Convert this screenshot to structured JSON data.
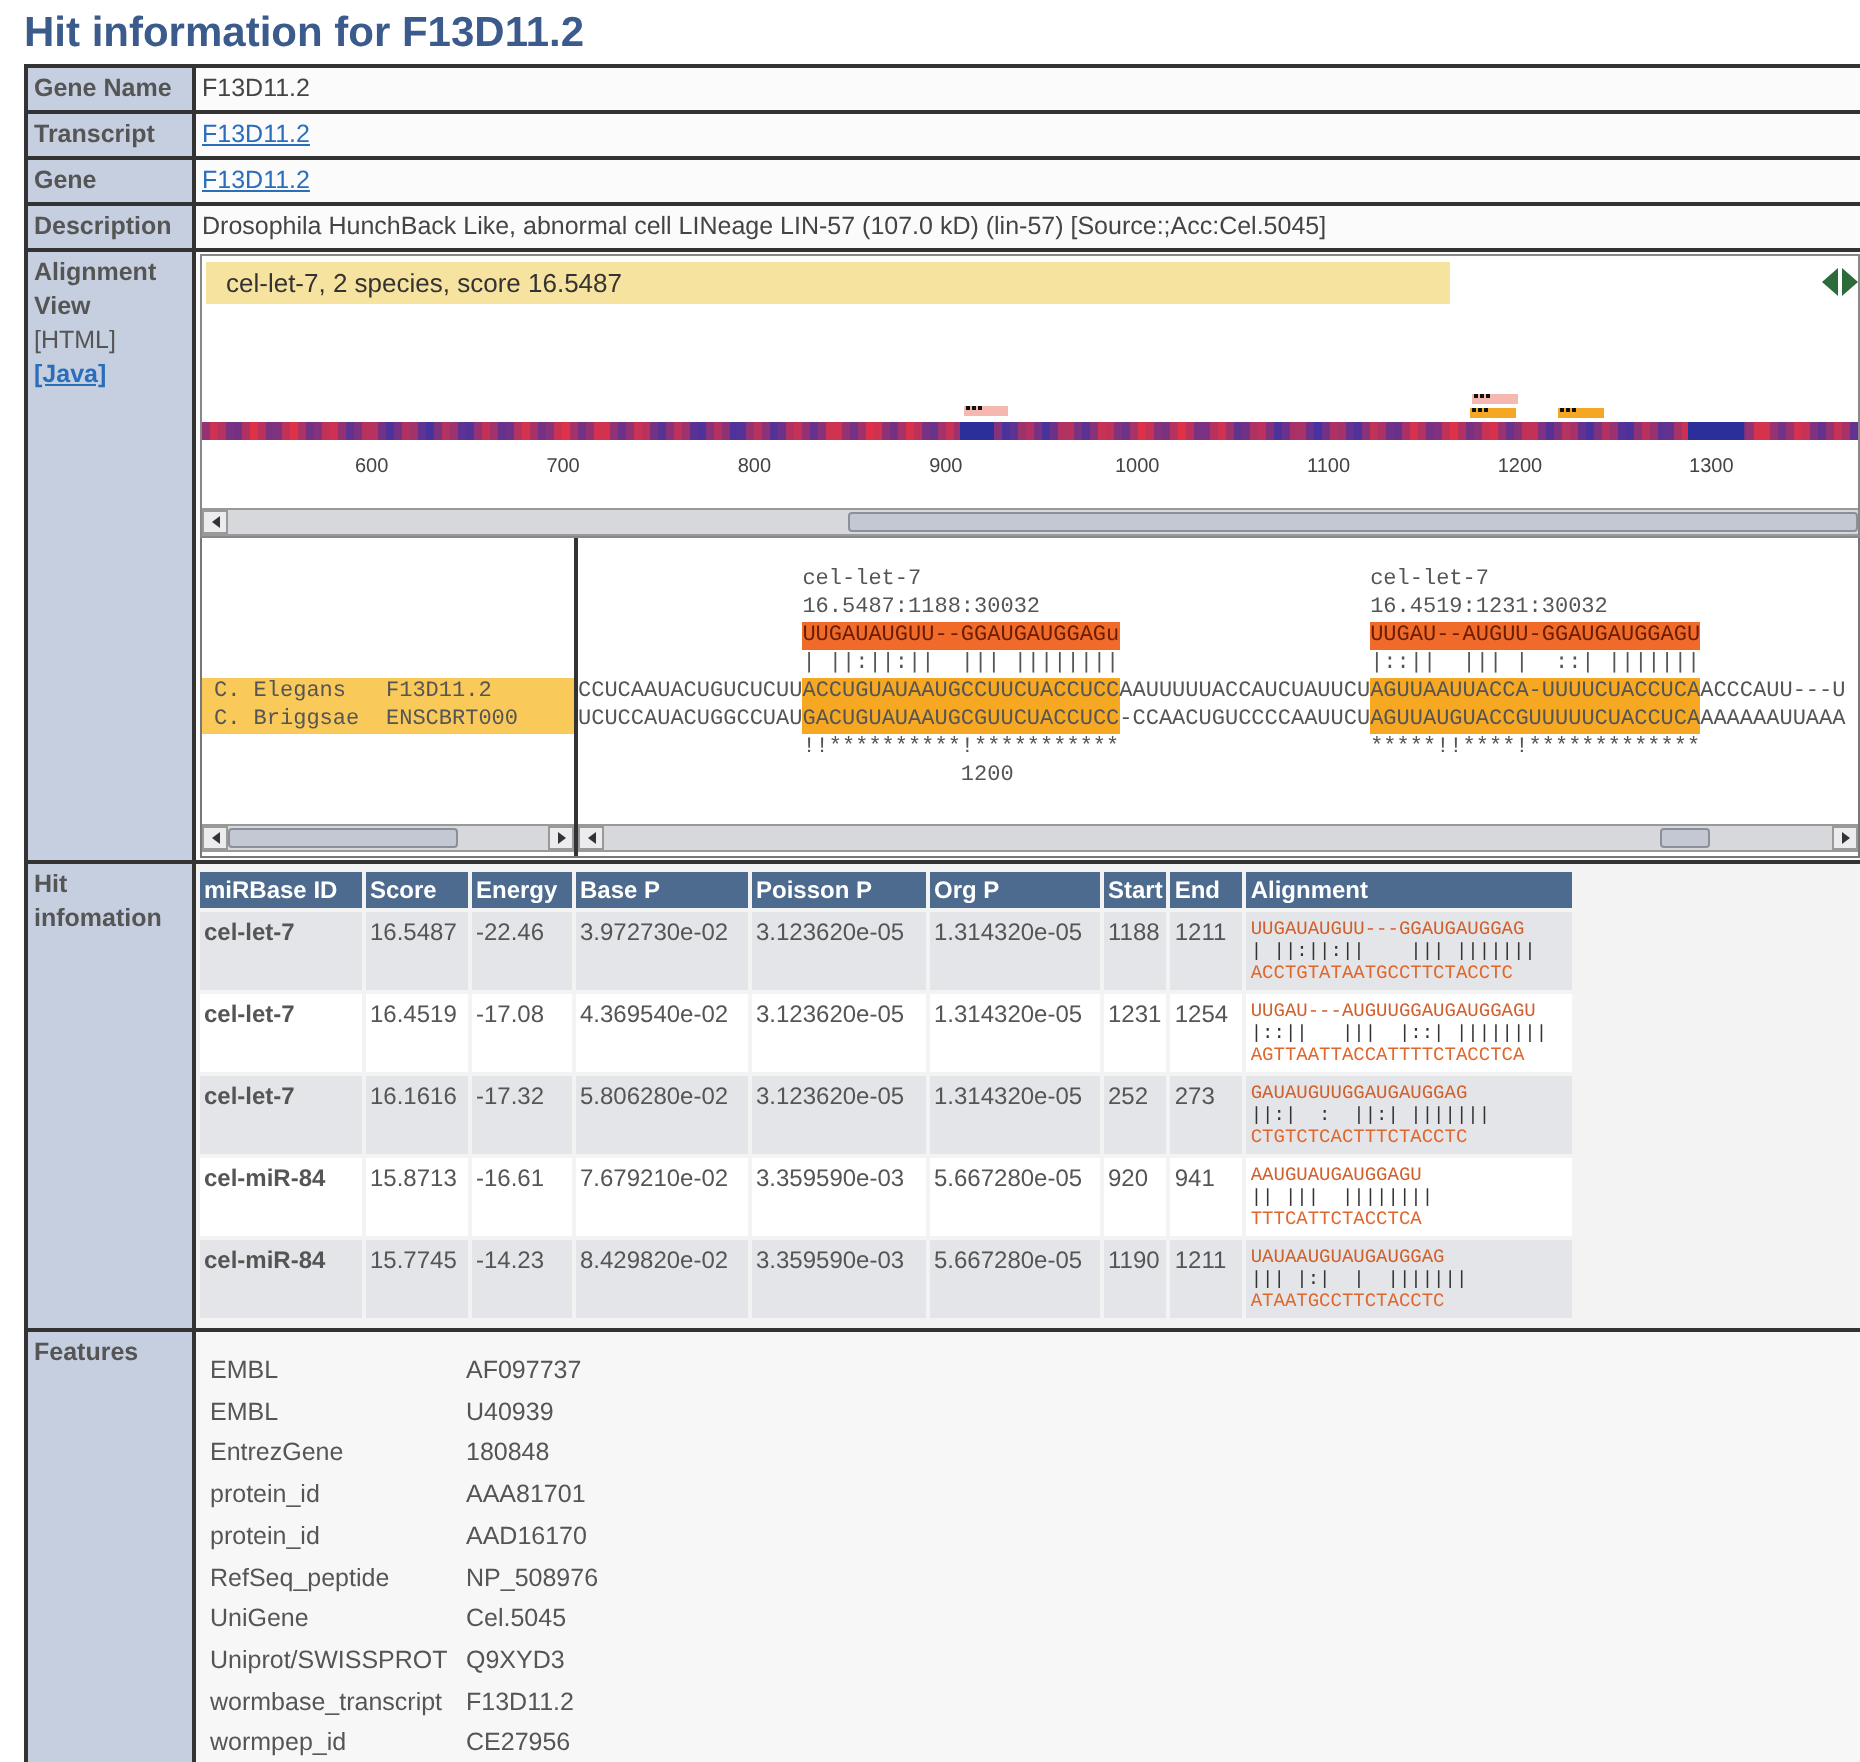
{
  "title": "Hit information for F13D11.2",
  "info_rows": [
    {
      "label": "Gene Name",
      "value": "F13D11.2",
      "kind": "text"
    },
    {
      "label": "Transcript",
      "value": "F13D11.2",
      "kind": "link"
    },
    {
      "label": "Gene",
      "value": "F13D11.2",
      "kind": "link"
    },
    {
      "label": "Description",
      "value": "Drosophila HunchBack Like, abnormal cell LINeage LIN-57 (107.0 kD) (lin-57) [Source:;Acc:Cel.5045]",
      "kind": "text"
    }
  ],
  "alignment_view": {
    "label": "Alignment View",
    "formats": [
      {
        "text": "[HTML]",
        "kind": "text"
      },
      {
        "text": "[Java]",
        "kind": "link"
      }
    ],
    "banner": "cel-let-7, 2 species, score 16.5487",
    "axis_ticks": [
      "600",
      "700",
      "800",
      "900",
      "1000",
      "1100",
      "1200",
      "1300"
    ],
    "species_rows": [
      {
        "species": "C. Elegans",
        "id": "F13D11.2"
      },
      {
        "species": "C. Briggsae",
        "id": "ENSCBRT000"
      }
    ],
    "hits": [
      {
        "name": "cel-let-7",
        "label": "16.5487:1188:30032",
        "mirna": "UUGAUAUGUU--GGAUGAUGGAGu",
        "pairing": "| ||:||:||  ||| ||||||||",
        "conservation": "!!**********!***********"
      },
      {
        "name": "cel-let-7",
        "label": "16.4519:1231:30032",
        "mirna": "UUGAU--AUGUU-GGAUGAUGGAGU",
        "pairing": "|::||  ||| |  ::| |||||||",
        "conservation": "*****!!****!*************"
      }
    ],
    "sequences": [
      [
        {
          "text": "CCUCAAUACUGUCUCUU",
          "highlighted": false
        },
        {
          "text": "ACCUGUAUAAUGCCUUCUACCUCC",
          "highlighted": true
        },
        {
          "text": "AAUUUUUACCAUCUAUUCU",
          "highlighted": false
        },
        {
          "text": "AGUUAAUUACCA-UUUUCUACCUCA",
          "highlighted": true
        },
        {
          "text": "ACCCAUU---U",
          "highlighted": false
        }
      ],
      [
        {
          "text": "UCUCCAUACUGGCCUAU",
          "highlighted": false
        },
        {
          "text": "GACUGUAUAAUGCGUUCUACCUCC",
          "highlighted": true
        },
        {
          "text": "-CCAACUGUCCCCAAUUCU",
          "highlighted": false
        },
        {
          "text": "AGUUAUGUACCGUUUUUCUACCUCA",
          "highlighted": true
        },
        {
          "text": "AAAAAAUUAAA",
          "highlighted": false
        }
      ]
    ],
    "position_label": "1200"
  },
  "hit_info": {
    "label": "Hit infomation",
    "columns": [
      "miRBase ID",
      "Score",
      "Energy",
      "Base P",
      "Poisson P",
      "Org P",
      "Start",
      "End",
      "Alignment"
    ],
    "rows": [
      {
        "cells": [
          "cel-let-7",
          "16.5487",
          "-22.46",
          "3.972730e-02",
          "3.123620e-05",
          "1.314320e-05",
          "1188",
          "1211"
        ],
        "alignment": [
          "UUGAUAUGUU---GGAUGAUGGAG",
          "| ||:||:||    ||| |||||||",
          "ACCTGTATAATGCCTTCTACCTC"
        ]
      },
      {
        "cells": [
          "cel-let-7",
          "16.4519",
          "-17.08",
          "4.369540e-02",
          "3.123620e-05",
          "1.314320e-05",
          "1231",
          "1254"
        ],
        "alignment": [
          "UUGAU---AUGUUGGAUGAUGGAGU",
          "|::||   |||  |::| ||||||||",
          "AGTTAATTACCATTTTCTACCTCA"
        ]
      },
      {
        "cells": [
          "cel-let-7",
          "16.1616",
          "-17.32",
          "5.806280e-02",
          "3.123620e-05",
          "1.314320e-05",
          "252",
          "273"
        ],
        "alignment": [
          "GAUAUGUUGGAUGAUGGAG",
          "||:|  :  ||:| |||||||",
          "CTGTCTCACTTTCTACCTC"
        ]
      },
      {
        "cells": [
          "cel-miR-84",
          "15.8713",
          "-16.61",
          "7.679210e-02",
          "3.359590e-03",
          "5.667280e-05",
          "920",
          "941"
        ],
        "alignment": [
          "AAUGUAUGAUGGAGU",
          "|| |||  ||||||||",
          "TTTCATTCTACCTCA"
        ]
      },
      {
        "cells": [
          "cel-miR-84",
          "15.7745",
          "-14.23",
          "8.429820e-02",
          "3.359590e-03",
          "5.667280e-05",
          "1190",
          "1211"
        ],
        "alignment": [
          "UAUAAUGUAUGAUGGAG",
          "||| |:|  |  |||||||",
          "ATAATGCCTTCTACCTC"
        ]
      }
    ]
  },
  "features": {
    "label": "Features",
    "items": [
      {
        "source": "EMBL",
        "id": "AF097737"
      },
      {
        "source": "EMBL",
        "id": "U40939"
      },
      {
        "source": "EntrezGene",
        "id": "180848"
      },
      {
        "source": "protein_id",
        "id": "AAA81701"
      },
      {
        "source": "protein_id",
        "id": "AAD16170"
      },
      {
        "source": "RefSeq_peptide",
        "id": "NP_508976"
      },
      {
        "source": "UniGene",
        "id": "Cel.5045"
      },
      {
        "source": "Uniprot/SWISSPROT",
        "id": "Q9XYD3"
      },
      {
        "source": "wormbase_transcript",
        "id": "F13D11.2"
      },
      {
        "source": "wormpep_id",
        "id": "CE27956"
      }
    ]
  }
}
